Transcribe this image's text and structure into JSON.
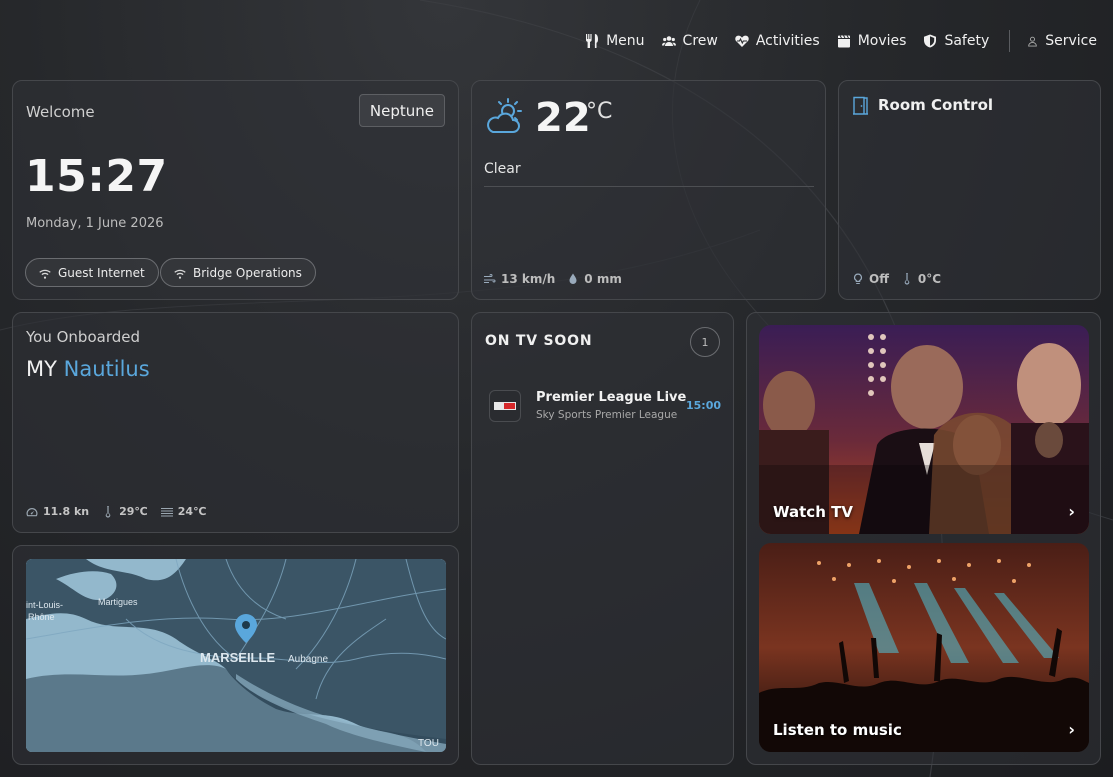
{
  "nav": {
    "items": [
      {
        "label": "Menu",
        "icon": "utensils-icon"
      },
      {
        "label": "Crew",
        "icon": "users-icon"
      },
      {
        "label": "Activities",
        "icon": "heart-pulse-icon"
      },
      {
        "label": "Movies",
        "icon": "clapperboard-icon"
      },
      {
        "label": "Safety",
        "icon": "shield-icon"
      }
    ],
    "service": {
      "label": "Service",
      "icon": "person-icon"
    }
  },
  "welcome": {
    "title": "Welcome",
    "location_button": "Neptune",
    "time": "15:27",
    "date": "Monday, 1 June 2026",
    "wifi": [
      {
        "label": "Guest Internet",
        "icon": "wifi-icon"
      },
      {
        "label": "Bridge Operations",
        "icon": "wifi-icon"
      }
    ]
  },
  "weather": {
    "temperature": "22",
    "unit": "°C",
    "condition": "Clear",
    "wind": "13 km/h",
    "rain": "0 mm",
    "icon": "partly-cloudy-icon"
  },
  "room": {
    "title": "Room Control",
    "light": "Off",
    "temperature": "0°C"
  },
  "onboard": {
    "subtitle": "You Onboarded",
    "prefix": "MY",
    "vessel": "Nautilus",
    "speed": "11.8 kn",
    "air_temp": "29℃",
    "water_temp": "24℃"
  },
  "map": {
    "labels": {
      "city": "MARSEILLE",
      "town1": "Aubagne",
      "town2": "Martigues",
      "town3a": "int-Louis-",
      "town3b": "Rhône",
      "town4": "TOU"
    }
  },
  "tv": {
    "heading": "ON TV SOON",
    "count": "1",
    "programs": [
      {
        "title": "Premier League Live",
        "channel": "Sky Sports Premier League",
        "time": "15:00"
      }
    ]
  },
  "media": {
    "tv_label": "Watch TV",
    "music_label": "Listen to music",
    "chevron": "›"
  },
  "colors": {
    "accent": "#5aa7dc",
    "background": "#26282b"
  }
}
